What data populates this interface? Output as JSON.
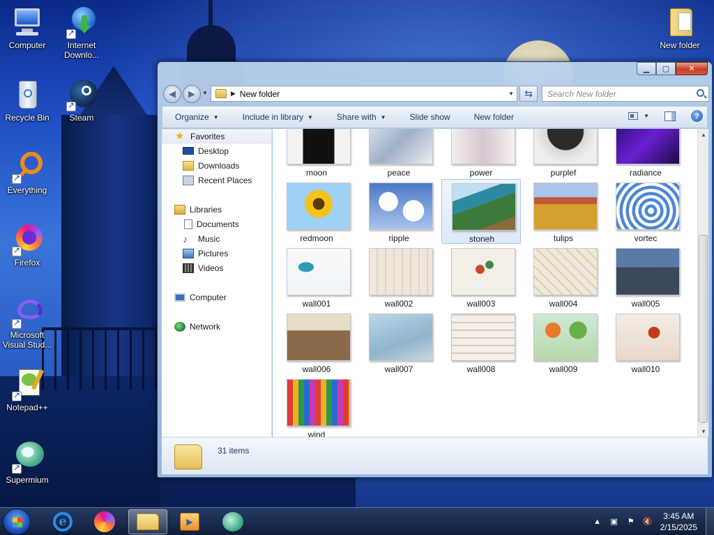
{
  "desktop": {
    "icons": [
      {
        "label": "Computer"
      },
      {
        "label": "Internet Downlo..."
      },
      {
        "label": "Recycle Bin"
      },
      {
        "label": "Steam"
      },
      {
        "label": "Everything"
      },
      {
        "label": "Firefox"
      },
      {
        "label": "Microsoft Visual Stud..."
      },
      {
        "label": "Notepad++"
      },
      {
        "label": "Supermium"
      },
      {
        "label": "New folder"
      }
    ]
  },
  "window": {
    "address": {
      "location": "New folder"
    },
    "search": {
      "placeholder": "Search New folder"
    },
    "toolbar": {
      "organize": "Organize",
      "include_in_library": "Include in library",
      "share_with": "Share with",
      "slide_show": "Slide show",
      "new_folder": "New folder"
    },
    "nav_pane": {
      "favorites": "Favorites",
      "desktop": "Desktop",
      "downloads": "Downloads",
      "recent_places": "Recent Places",
      "libraries": "Libraries",
      "documents": "Documents",
      "music": "Music",
      "pictures": "Pictures",
      "videos": "Videos",
      "computer": "Computer",
      "network": "Network"
    },
    "files": [
      {
        "name": "moon"
      },
      {
        "name": "peace"
      },
      {
        "name": "power"
      },
      {
        "name": "purplef"
      },
      {
        "name": "radiance"
      },
      {
        "name": "redmoon"
      },
      {
        "name": "ripple"
      },
      {
        "name": "stoneh"
      },
      {
        "name": "tulips"
      },
      {
        "name": "vortec"
      },
      {
        "name": "wall001"
      },
      {
        "name": "wall002"
      },
      {
        "name": "wall003"
      },
      {
        "name": "wall004"
      },
      {
        "name": "wall005"
      },
      {
        "name": "wall006"
      },
      {
        "name": "wall007"
      },
      {
        "name": "wall008"
      },
      {
        "name": "wall009"
      },
      {
        "name": "wall010"
      },
      {
        "name": "wind"
      }
    ],
    "selected_file": "stoneh",
    "details": {
      "item_count": "31 items"
    }
  },
  "taskbar": {
    "clock": {
      "time": "3:45 AM",
      "date": "2/15/2025"
    }
  }
}
